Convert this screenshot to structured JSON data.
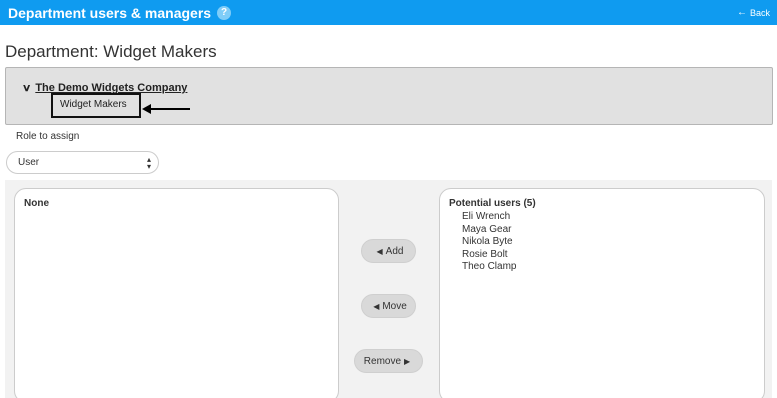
{
  "header": {
    "title": "Department users & managers",
    "help_icon": "?",
    "back_arrow": "←",
    "back_label": "Back"
  },
  "page_title": "Department: Widget Makers",
  "tree": {
    "root_label": "The Demo Widgets Company",
    "child_label": "Widget Makers"
  },
  "role": {
    "label": "Role to assign",
    "selected": "User"
  },
  "left_list": {
    "header": "None",
    "items": []
  },
  "right_list": {
    "header": "Potential users (5)",
    "items": [
      "Eli Wrench",
      "Maya Gear",
      "Nikola Byte",
      "Rosie Bolt",
      "Theo Clamp"
    ]
  },
  "buttons": {
    "add": "Add",
    "move": "Move",
    "remove": "Remove"
  },
  "colors": {
    "accent": "#0f9bf0",
    "tree_bg": "#e1e1e1",
    "panel_bg": "#f2f2f2"
  }
}
